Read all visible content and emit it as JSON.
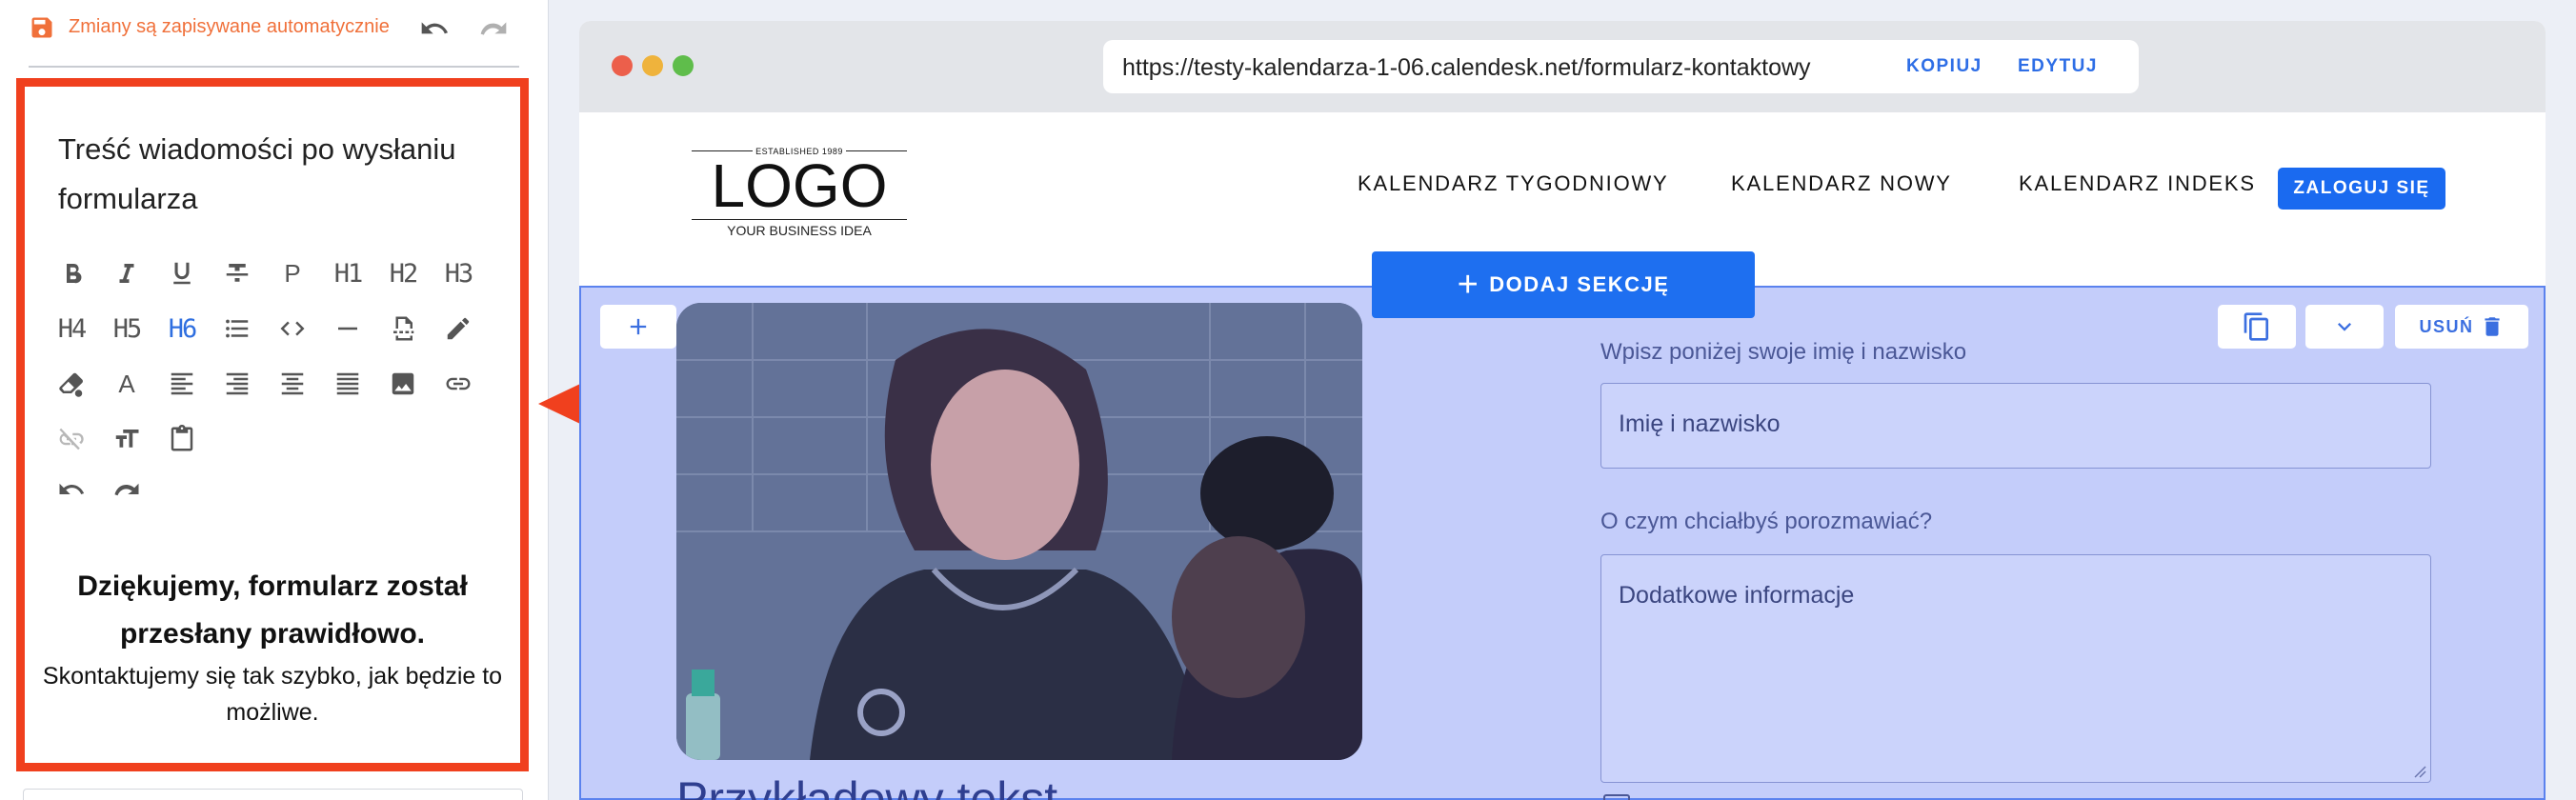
{
  "editor": {
    "autosave_text": "Zmiany są zapisywane automatycznie",
    "section_title": "Treść wiadomości po wysłaniu formularza",
    "toolbar": [
      {
        "name": "bold",
        "kind": "icon",
        "icon": "bold-icon"
      },
      {
        "name": "italic",
        "kind": "icon",
        "icon": "italic-icon"
      },
      {
        "name": "underline",
        "kind": "icon",
        "icon": "underline-icon"
      },
      {
        "name": "strikethrough",
        "kind": "icon",
        "icon": "strikethrough-icon"
      },
      {
        "name": "paragraph",
        "kind": "text",
        "label": "P"
      },
      {
        "name": "h1",
        "kind": "text",
        "label": "H1"
      },
      {
        "name": "h2",
        "kind": "text",
        "label": "H2"
      },
      {
        "name": "h3",
        "kind": "text",
        "label": "H3"
      },
      {
        "name": "h4",
        "kind": "text",
        "label": "H4"
      },
      {
        "name": "h5",
        "kind": "text",
        "label": "H5"
      },
      {
        "name": "h6",
        "kind": "text",
        "label": "H6",
        "active": true
      },
      {
        "name": "bullet-list",
        "kind": "icon",
        "icon": "list-icon"
      },
      {
        "name": "code",
        "kind": "icon",
        "icon": "code-icon"
      },
      {
        "name": "horizontal-rule",
        "kind": "icon",
        "icon": "minus-icon"
      },
      {
        "name": "page-break",
        "kind": "icon",
        "icon": "page-break-icon"
      },
      {
        "name": "highlight",
        "kind": "icon",
        "icon": "pen-icon"
      },
      {
        "name": "clear-format",
        "kind": "icon",
        "icon": "eraser-icon"
      },
      {
        "name": "font-color",
        "kind": "text",
        "label": "A"
      },
      {
        "name": "align-left",
        "kind": "icon",
        "icon": "align-left-icon"
      },
      {
        "name": "align-right",
        "kind": "icon",
        "icon": "align-right-icon"
      },
      {
        "name": "align-center",
        "kind": "icon",
        "icon": "align-center-icon"
      },
      {
        "name": "align-justify",
        "kind": "icon",
        "icon": "align-justify-icon"
      },
      {
        "name": "image",
        "kind": "icon",
        "icon": "image-icon"
      },
      {
        "name": "link",
        "kind": "icon",
        "icon": "link-icon"
      },
      {
        "name": "unlink",
        "kind": "icon",
        "icon": "unlink-icon",
        "disabled": true
      },
      {
        "name": "font-size",
        "kind": "icon",
        "icon": "text-size-icon"
      },
      {
        "name": "paste",
        "kind": "icon",
        "icon": "clipboard-icon"
      },
      {
        "name": "undo",
        "kind": "icon",
        "icon": "undo-icon"
      },
      {
        "name": "redo",
        "kind": "icon",
        "icon": "redo-icon"
      }
    ],
    "preview_title": "Dziękujemy, formularz został przesłany prawidłowo.",
    "preview_body": "Skontaktujemy się tak szybko, jak będzie to możliwe."
  },
  "browser": {
    "url": "https://testy-kalendarza-1-06.calendesk.net/formularz-kontaktowy",
    "copy_label": "KOPIUJ",
    "edit_label": "EDYTUJ"
  },
  "site": {
    "logo": {
      "established": "ESTABLISHED 1989",
      "main": "LOGO",
      "tagline": "YOUR BUSINESS IDEA"
    },
    "nav": [
      "KALENDARZ TYGODNIOWY",
      "KALENDARZ NOWY",
      "KALENDARZ INDEKS"
    ],
    "login_label": "ZALOGUJ SIĘ",
    "add_section_label": "DODAJ SEKCJĘ",
    "delete_label": "USUŃ",
    "form": {
      "name_label": "Wpisz poniżej swoje imię i nazwisko",
      "name_placeholder": "Imię i nazwisko",
      "topic_label": "O czym chciałbyś porozmawiać?",
      "topic_placeholder": "Dodatkowe informacje"
    },
    "caption": "Przykładowy tekst"
  },
  "colors": {
    "autosave": "#f0703a",
    "highlight_border": "#f0401e",
    "accent": "#1e6ff0",
    "section_overlay": "#c4cdfa",
    "active_tool": "#2f6fe0"
  }
}
